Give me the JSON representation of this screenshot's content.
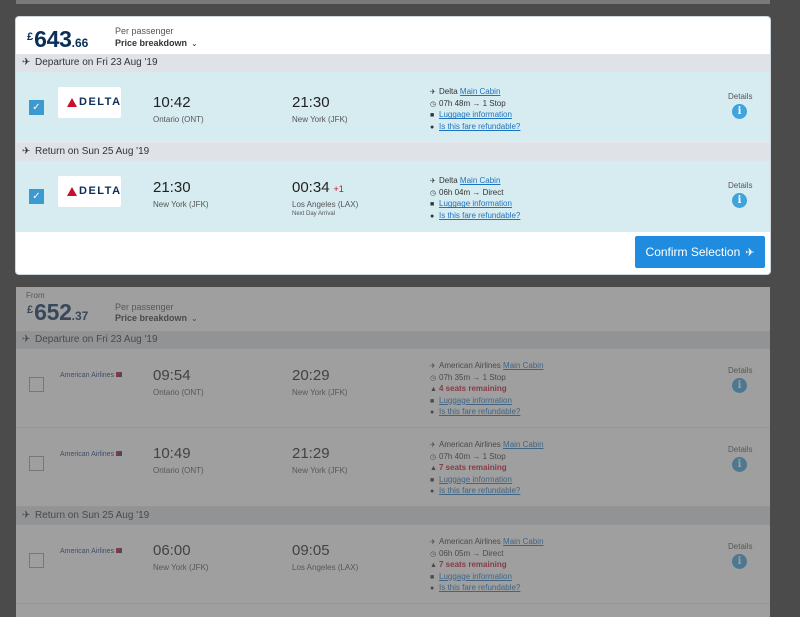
{
  "option1": {
    "currency": "£",
    "price_main": "643",
    "price_dec": ".66",
    "per_passenger": "Per passenger",
    "price_breakdown": "Price breakdown",
    "departure_header": "Departure on Fri 23 Aug '19",
    "return_header": "Return on Sun 25 Aug '19",
    "departure": {
      "airline_logo": "DELTA",
      "depart_time": "10:42",
      "depart_place": "Ontario (ONT)",
      "arrive_time": "21:30",
      "arrive_place": "New York (JFK)",
      "carrier": "Delta",
      "cabin": "Main Cabin",
      "duration": "07h 48m → 1 Stop",
      "luggage": "Luggage information",
      "refundable": "Is this fare refundable?",
      "details": "Details"
    },
    "return": {
      "airline_logo": "DELTA",
      "depart_time": "21:30",
      "depart_place": "New York (JFK)",
      "arrive_time": "00:34",
      "plus_day": "+1",
      "arrive_place": "Los Angeles (LAX)",
      "next_day": "Next Day Arrival",
      "carrier": "Delta",
      "cabin": "Main Cabin",
      "duration": "06h 04m → Direct",
      "luggage": "Luggage information",
      "refundable": "Is this fare refundable?",
      "details": "Details"
    },
    "confirm_label": "Confirm Selection"
  },
  "option2": {
    "from_label": "From",
    "currency": "£",
    "price_main": "652",
    "price_dec": ".37",
    "per_passenger": "Per passenger",
    "price_breakdown": "Price breakdown",
    "departure_header": "Departure on Fri 23 Aug '19",
    "return_header": "Return on Sun 25 Aug '19",
    "flights": [
      {
        "airline_logo": "American Airlines",
        "depart_time": "09:54",
        "depart_place": "Ontario (ONT)",
        "arrive_time": "20:29",
        "arrive_place": "New York (JFK)",
        "carrier": "American Airlines",
        "cabin": "Main Cabin",
        "duration": "07h 35m → 1 Stop",
        "seats": "4 seats remaining",
        "luggage": "Luggage information",
        "refundable": "Is this fare refundable?",
        "details": "Details"
      },
      {
        "airline_logo": "American Airlines",
        "depart_time": "10:49",
        "depart_place": "Ontario (ONT)",
        "arrive_time": "21:29",
        "arrive_place": "New York (JFK)",
        "carrier": "American Airlines",
        "cabin": "Main Cabin",
        "duration": "07h 40m → 1 Stop",
        "seats": "7 seats remaining",
        "luggage": "Luggage information",
        "refundable": "Is this fare refundable?",
        "details": "Details"
      },
      {
        "airline_logo": "American Airlines",
        "depart_time": "06:00",
        "depart_place": "New York (JFK)",
        "arrive_time": "09:05",
        "arrive_place": "Los Angeles (LAX)",
        "carrier": "American Airlines",
        "cabin": "Main Cabin",
        "duration": "06h 05m → Direct",
        "seats": "7 seats remaining",
        "luggage": "Luggage information",
        "refundable": "Is this fare refundable?",
        "details": "Details"
      }
    ]
  },
  "colors": {
    "accent": "#1f8ce0",
    "selected_row": "#d7ecf1",
    "price": "#0b2e59",
    "warning": "#c8102e"
  }
}
